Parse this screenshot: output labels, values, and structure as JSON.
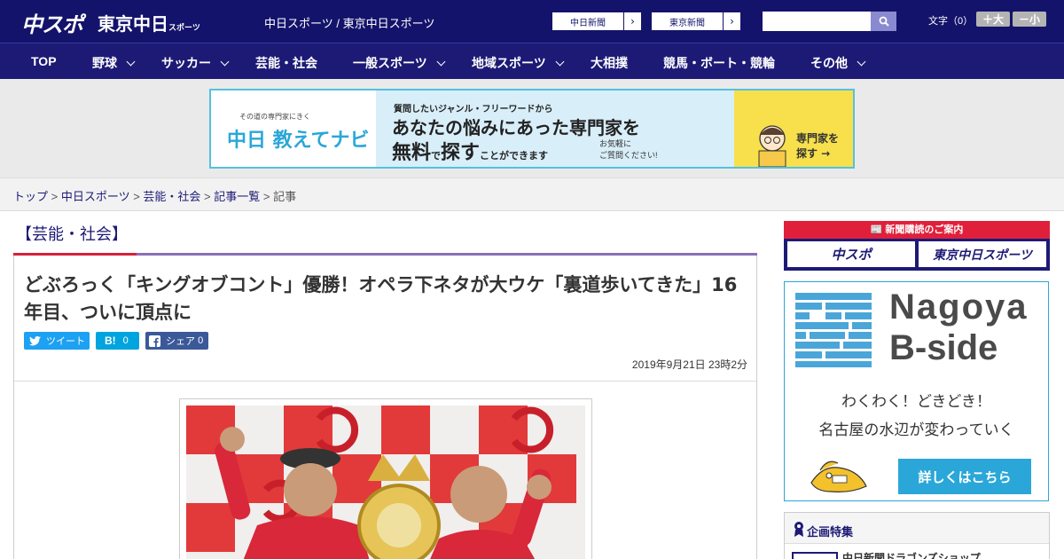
{
  "header": {
    "logo_chuspo": "中スポ",
    "logo_tokyo": "東京中日",
    "logo_tokyo_sub": "スポーツ",
    "site_title": "中日スポーツ / 東京中日スポーツ",
    "paper_buttons": [
      "中日新聞",
      "東京新聞"
    ],
    "text_size_label": "文字（0）",
    "size_plus": "＋大",
    "size_minus": "－小"
  },
  "nav": {
    "items": [
      {
        "label": "TOP",
        "has_menu": false
      },
      {
        "label": "野球",
        "has_menu": true
      },
      {
        "label": "サッカー",
        "has_menu": true
      },
      {
        "label": "芸能・社会",
        "has_menu": false
      },
      {
        "label": "一般スポーツ",
        "has_menu": true
      },
      {
        "label": "地域スポーツ",
        "has_menu": true
      },
      {
        "label": "大相撲",
        "has_menu": false
      },
      {
        "label": "競馬・ボート・競輪",
        "has_menu": false
      },
      {
        "label": "その他",
        "has_menu": true
      }
    ]
  },
  "ad_banner": {
    "small": "その道の専門家にきく",
    "brand": "中日 教えてナビ",
    "line1": "質問したいジャンル・フリーワードから",
    "line2": "あなたの悩みにあった専門家を",
    "line3_a": "無料",
    "line3_b": "で",
    "line3_c": "探す",
    "line3_d": "ことができます",
    "note1": "お気軽に",
    "note2": "ご質問ください!",
    "cta1": "専門家を",
    "cta2": "探す →"
  },
  "breadcrumb": {
    "items": [
      "トップ",
      "中日スポーツ",
      "芸能・社会",
      "記事一覧"
    ],
    "current": "記事",
    "sep": " > "
  },
  "article": {
    "category": "【芸能・社会】",
    "headline": "どぶろっく「キングオブコント」優勝！オペラ下ネタが大ウケ「裏道歩いてきた」16年目、ついに頂点に",
    "share": {
      "tweet": "ツイート",
      "hatena": "B!",
      "hatena_count": "0",
      "facebook": "シェア",
      "facebook_count": "0"
    },
    "date": "2019年9月21日 23時2分"
  },
  "sidebar": {
    "subscribe_head": "新聞購読のご案内",
    "subscribe_buttons": [
      "中スポ",
      "東京中日スポーツ"
    ],
    "nagoya_title1": "Nagoya",
    "nagoya_title2": "B-side",
    "nagoya_copy1": "わくわく！どきどき！",
    "nagoya_copy2": "名古屋の水辺が変わっていく",
    "nagoya_button": "詳しくはこちら",
    "kikaku_title": "企画特集",
    "kikaku_item": "中日新聞ドラゴンズショップ"
  },
  "colors": {
    "brand_navy": "#14136b",
    "accent_red": "#d6203b",
    "accent_blue": "#2aa7d8",
    "banner_yellow": "#f8e04c"
  }
}
